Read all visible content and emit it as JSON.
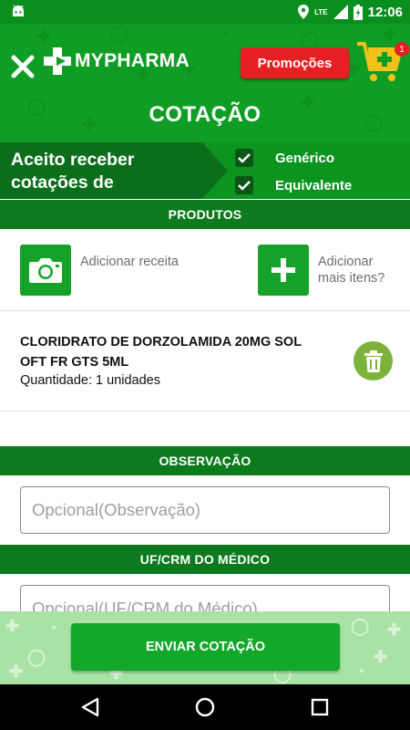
{
  "status_bar": {
    "time": "12:06",
    "network": "LTE",
    "icons": [
      "android-icon",
      "location-icon",
      "signal-icon",
      "battery-icon"
    ]
  },
  "header": {
    "logo_text": "MYPHARMA",
    "promo_label": "Promoções",
    "cart_count": "1"
  },
  "page": {
    "title": "COTAÇÃO"
  },
  "accept": {
    "label": "Aceito receber cotações de",
    "options": [
      {
        "label": "Genérico",
        "checked": true
      },
      {
        "label": "Equivalente",
        "checked": true
      }
    ]
  },
  "products_section": {
    "title": "PRODUTOS",
    "add_prescription_label": "Adicionar receita",
    "add_more_label": "Adicionar mais itens?",
    "items": [
      {
        "name": "CLORIDRATO DE DORZOLAMIDA 20MG SOL OFT FR GTS 5ML",
        "quantity": "Quantidade: 1 unidades"
      }
    ]
  },
  "observation_section": {
    "title": "OBSERVAÇÃO",
    "placeholder": "Opcional(Observação)",
    "value": ""
  },
  "doctor_section": {
    "title": "UF/CRM DO MÉDICO",
    "placeholder": "Opcional(UF/CRM do Médico)",
    "value": ""
  },
  "submit_label": "ENVIAR COTAÇÃO",
  "colors": {
    "brand_green": "#0f9d24",
    "dark_green": "#0c7a1d",
    "promo_red": "#e51f22",
    "cart_yellow": "#f2c21b",
    "trash_green": "#7db23a"
  }
}
